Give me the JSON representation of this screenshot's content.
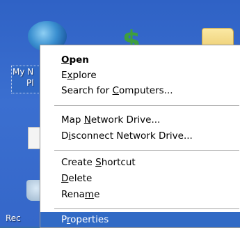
{
  "desktop": {
    "labels": {
      "my_network": "My N",
      "my_network_line2": "Pl",
      "recycle": "Rec"
    }
  },
  "context_menu": {
    "items": [
      {
        "label": "Open",
        "accesskey": "O",
        "bold": true
      },
      {
        "label": "Explore",
        "accesskey": "x"
      },
      {
        "label": "Search for Computers...",
        "accesskey": "C"
      },
      {
        "label": "Map Network Drive...",
        "accesskey": "N"
      },
      {
        "label": "Disconnect Network Drive...",
        "accesskey": "i"
      },
      {
        "label": "Create Shortcut",
        "accesskey": "S"
      },
      {
        "label": "Delete",
        "accesskey": "D"
      },
      {
        "label": "Rename",
        "accesskey": "m"
      },
      {
        "label": "Properties",
        "accesskey": "r",
        "selected": true
      }
    ]
  }
}
